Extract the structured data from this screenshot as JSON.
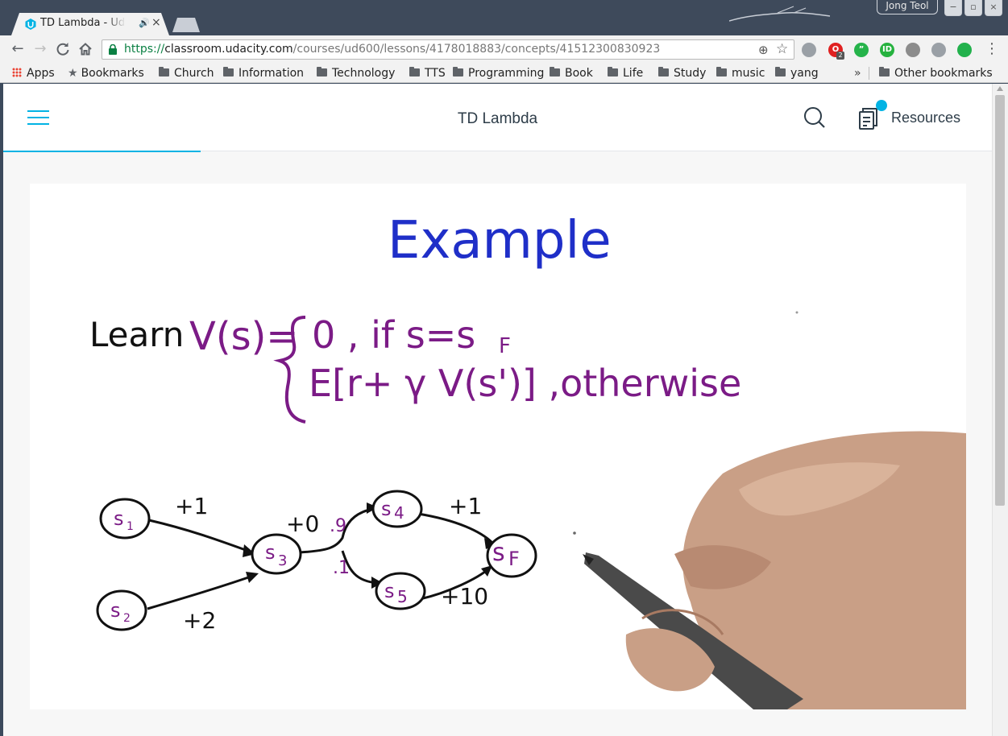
{
  "browser": {
    "tab": {
      "title": "TD Lambda - Udacity",
      "close": "×",
      "audio": "🔊"
    },
    "user_name": "Jong Teol",
    "window_buttons": [
      "−",
      "▫",
      "×"
    ],
    "toolbar": {
      "back": "←",
      "forward": "→",
      "reload": "C",
      "home": "⌂",
      "url_scheme": "https://",
      "url_host": "classroom.udacity.com",
      "url_path": "/courses/ud600/lessons/4178018883/concepts/41512300830923",
      "zoom_icon": "⊕",
      "star_icon": "☆",
      "menu": "⋮"
    },
    "extensions": [
      {
        "name": "key-icon",
        "color": "#9aa0a6",
        "label": ""
      },
      {
        "name": "opera-icon",
        "color": "#e02020",
        "label": "O"
      },
      {
        "name": "quote-icon",
        "color": "#25b34a",
        "label": "”"
      },
      {
        "name": "id-icon",
        "color": "#26b23f",
        "label": "ID"
      },
      {
        "name": "ext-box-icon",
        "color": "#8c8c8c",
        "label": ""
      },
      {
        "name": "rocket-icon",
        "color": "#9aa0a6",
        "label": ""
      },
      {
        "name": "cloud-icon",
        "color": "#22b14c",
        "label": ""
      }
    ],
    "extension_badge": "2",
    "bookmarks": {
      "apps": "Apps",
      "bookmarks": "Bookmarks",
      "folders": [
        "Church",
        "Information",
        "Technology",
        "TTS",
        "Programming",
        "Book",
        "Life",
        "Study",
        "music",
        "yang"
      ],
      "overflow": "»",
      "other": "Other bookmarks"
    }
  },
  "page": {
    "title": "TD Lambda",
    "resources_label": "Resources",
    "progress_fraction": 0.2
  },
  "lecture": {
    "heading": "Example",
    "learn_label": "Learn",
    "equation_lhs": "V(s)=",
    "case1": "0 , if s=s",
    "case1_sub": "F",
    "case2": "E[r+ γ V(s')] ,otherwise",
    "nodes": {
      "s1": "s",
      "s1_sub": "1",
      "s2": "s",
      "s2_sub": "2",
      "s3": "s",
      "s3_sub": "3",
      "s4": "s",
      "s4_sub": "4",
      "s5": "s",
      "s5_sub": "5",
      "sf": "s",
      "sf_sub": "F"
    },
    "edges": {
      "s1_s3": "+1",
      "s2_s3": "+2",
      "s3_branch": "+0",
      "p_s4": ".9",
      "p_s5": ".1",
      "s4_sf": "+1",
      "s5_sf": "+10"
    }
  }
}
